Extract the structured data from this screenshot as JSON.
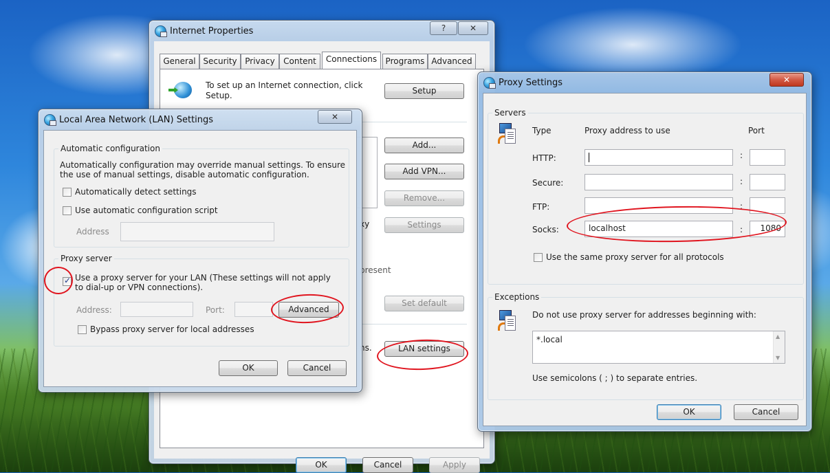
{
  "internet_properties": {
    "title": "Internet Properties",
    "help_btn": "?",
    "close_btn": "✕",
    "tabs": [
      "General",
      "Security",
      "Privacy",
      "Content",
      "Connections",
      "Programs",
      "Advanced"
    ],
    "setup_text": "To set up an Internet connection, click Setup.",
    "setup_btn": "Setup",
    "add_btn": "Add...",
    "add_vpn_btn": "Add VPN...",
    "remove_btn": "Remove...",
    "settings_btn": "Settings",
    "partial_proxy": "xy",
    "partial_present": "present",
    "set_default_btn": "Set default",
    "partial_ns": "ns.",
    "lan_settings_btn": "LAN settings",
    "ok_btn": "OK",
    "cancel_btn": "Cancel",
    "apply_btn": "Apply"
  },
  "lan_settings": {
    "title": "Local Area Network (LAN) Settings",
    "close_btn": "✕",
    "auto_group": "Automatic configuration",
    "auto_desc": "Automatically configuration may override manual settings.  To ensure the use of manual settings, disable automatic configuration.",
    "auto_detect": "Automatically detect settings",
    "auto_script": "Use automatic configuration script",
    "address_label": "Address",
    "proxy_group": "Proxy server",
    "use_proxy": "Use a proxy server for your LAN (These settings will not apply to dial-up or VPN connections).",
    "address2_label": "Address:",
    "port_label": "Port:",
    "advanced_btn": "Advanced",
    "bypass": "Bypass proxy server for local addresses",
    "ok_btn": "OK",
    "cancel_btn": "Cancel"
  },
  "proxy_settings": {
    "title": "Proxy Settings",
    "close_btn": "✕",
    "servers_group": "Servers",
    "col_type": "Type",
    "col_address": "Proxy address to use",
    "col_port": "Port",
    "rows": [
      {
        "type": "HTTP:",
        "address": "",
        "port": ""
      },
      {
        "type": "Secure:",
        "address": "",
        "port": ""
      },
      {
        "type": "FTP:",
        "address": "",
        "port": ""
      },
      {
        "type": "Socks:",
        "address": "localhost",
        "port": "1080"
      }
    ],
    "colon": ":",
    "same_proxy": "Use the same proxy server for all protocols",
    "exceptions_group": "Exceptions",
    "exceptions_desc": "Do not use proxy server for addresses beginning with:",
    "exceptions_value": "*.local",
    "semicolons_hint": "Use semicolons ( ; ) to separate entries.",
    "ok_btn": "OK",
    "cancel_btn": "Cancel"
  }
}
